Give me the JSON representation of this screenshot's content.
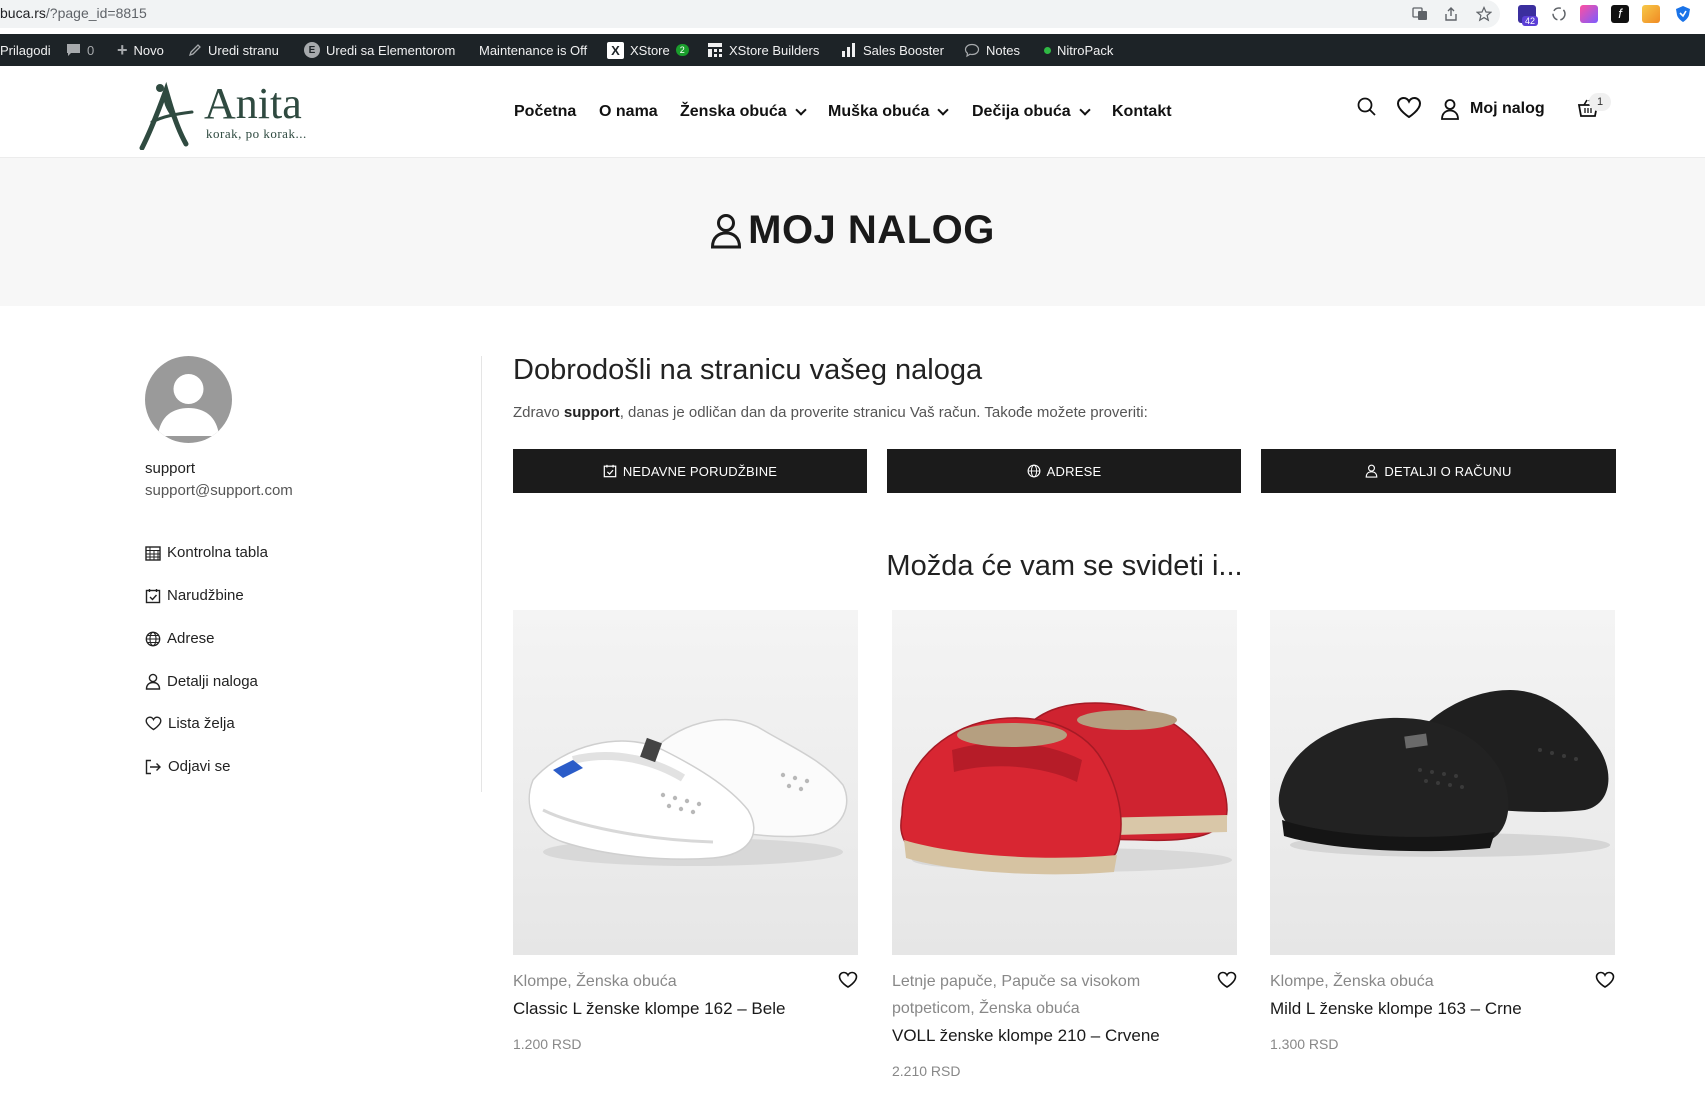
{
  "browser": {
    "url_main": "buca.rs",
    "url_rest": "/?page_id=8815",
    "ext_badge": "42"
  },
  "adminbar": {
    "customize": "Prilagodi",
    "comments_count": "0",
    "new_label": "Novo",
    "edit_page": "Uredi stranu",
    "edit_elementor": "Uredi sa Elementorom",
    "maintenance": "Maintenance is Off",
    "xstore": "XStore",
    "xstore_badge": "2",
    "builders": "XStore Builders",
    "sales": "Sales Booster",
    "notes": "Notes",
    "nitropack": "NitroPack"
  },
  "header": {
    "logo_name": "Anita",
    "logo_tag": "korak, po korak...",
    "nav": [
      "Početna",
      "O nama",
      "Ženska obuća",
      "Muška obuća",
      "Dečija obuća",
      "Kontakt"
    ],
    "account_label": "Moj nalog",
    "cart_count": "1"
  },
  "hero": {
    "title": "MOJ NALOG"
  },
  "sidebar": {
    "username": "support",
    "email": "support@support.com",
    "links": [
      "Kontrolna tabla",
      "Narudžbine",
      "Adrese",
      "Detalji naloga",
      "Lista želja",
      "Odjavi se"
    ]
  },
  "main": {
    "welcome": "Dobrodošli na stranicu vašeg naloga",
    "greet_pre": "Zdravo",
    "greet_user": "support",
    "greet_post": ", danas je odličan dan da proverite stranicu Vaš račun. Takođe možete proveriti:",
    "buttons": [
      "NEDAVNE PORUDŽBINE",
      "ADRESE",
      "DETALJI O RAČUNU"
    ],
    "maybe_title": "Možda će vam se svideti i..."
  },
  "products": [
    {
      "cats": "Klompe, Ženska obuća",
      "name": "Classic L ženske klompe 162 – Bele",
      "price": "1.200 RSD"
    },
    {
      "cats": "Letnje papuče, Papuče sa visokom potpeticom, Ženska obuća",
      "name": "VOLL ženske klompe 210 – Crvene",
      "price": "2.210 RSD"
    },
    {
      "cats": "Klompe, Ženska obuća",
      "name": "Mild L ženske klompe 163 – Crne",
      "price": "1.300 RSD"
    }
  ],
  "colors": {
    "accent": "#1b1b1b",
    "brand": "#2f4a40",
    "admin_bar": "#1d2327"
  }
}
